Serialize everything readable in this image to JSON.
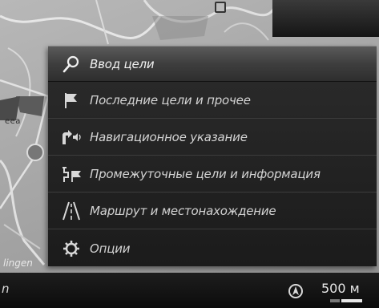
{
  "map": {
    "label_geo": "ееа",
    "label_city": "lingen",
    "icons": {
      "position_marker": "circle-marker-icon",
      "pin": "map-pin-icon"
    }
  },
  "menu": {
    "items": [
      {
        "label": "Ввод цели",
        "icon": "search-icon",
        "selected": true
      },
      {
        "label": "Последние цели и прочее",
        "icon": "flag-icon",
        "selected": false
      },
      {
        "label": "Навигационное указание",
        "icon": "turn-sound-icon",
        "selected": false
      },
      {
        "label": "Промежуточные цели и информация",
        "icon": "waypoint-flag-icon",
        "selected": false
      },
      {
        "label": "Маршрут и местонахождение",
        "icon": "road-icon",
        "selected": false
      },
      {
        "label": "Опции",
        "icon": "gear-icon",
        "selected": false
      }
    ]
  },
  "status": {
    "left_text": "n",
    "compass_icon": "compass-icon",
    "scale": "500 м"
  }
}
